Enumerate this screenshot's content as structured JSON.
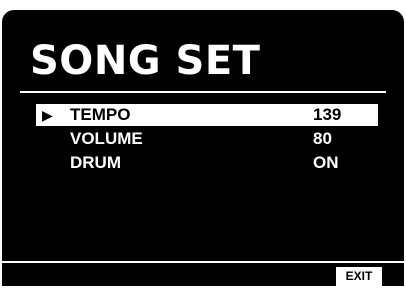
{
  "screen": {
    "title": "SONG SET",
    "cursor_glyph": "▶",
    "menu": [
      {
        "label": "TEMPO",
        "value": "139",
        "selected": true
      },
      {
        "label": "VOLUME",
        "value": "80",
        "selected": false
      },
      {
        "label": "DRUM",
        "value": "ON",
        "selected": false
      }
    ],
    "exit_label": "EXIT"
  },
  "colors": {
    "background": "#000000",
    "foreground": "#ffffff"
  }
}
